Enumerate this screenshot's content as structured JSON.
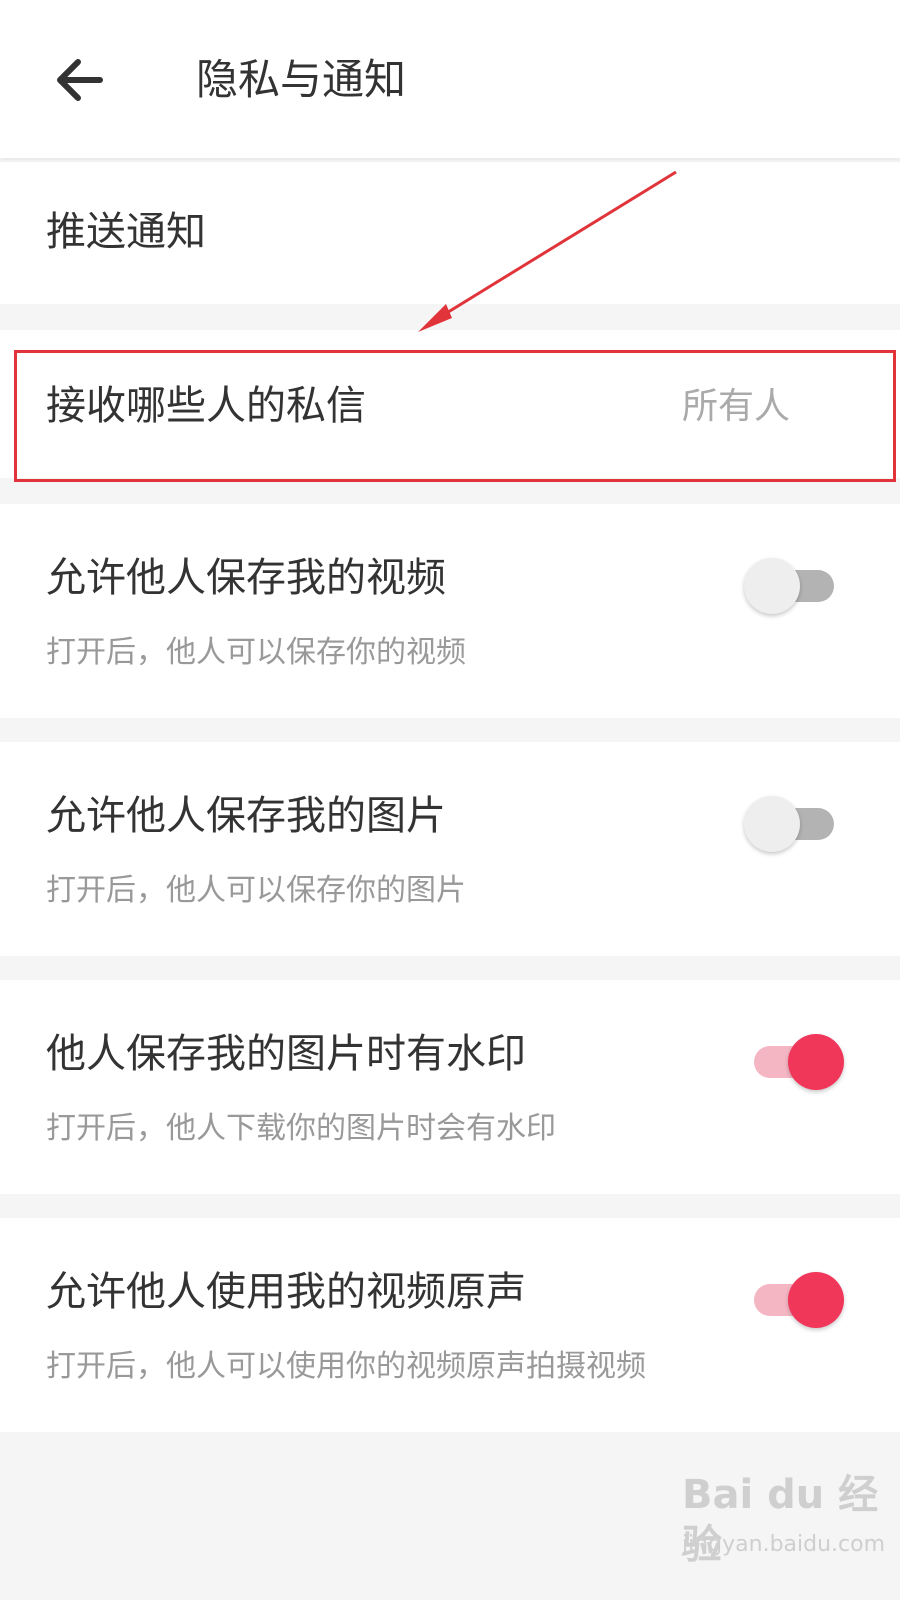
{
  "header": {
    "title": "隐私与通知",
    "back_icon": "arrow-left-icon"
  },
  "push": {
    "title": "推送通知"
  },
  "dm": {
    "title": "接收哪些人的私信",
    "value": "所有人"
  },
  "settings": [
    {
      "title": "允许他人保存我的视频",
      "desc": "打开后，他人可以保存你的视频",
      "on": false
    },
    {
      "title": "允许他人保存我的图片",
      "desc": "打开后，他人可以保存你的图片",
      "on": false
    },
    {
      "title": "他人保存我的图片时有水印",
      "desc": "打开后，他人下载你的图片时会有水印",
      "on": true
    },
    {
      "title": "允许他人使用我的视频原声",
      "desc": "打开后，他人可以使用你的视频原声拍摄视频",
      "on": true
    }
  ],
  "watermark": {
    "main": "Bai du 经验",
    "sub": "jingyan.baidu.com"
  },
  "colors": {
    "accent": "#f0375a",
    "annotation": "#e0343a"
  }
}
